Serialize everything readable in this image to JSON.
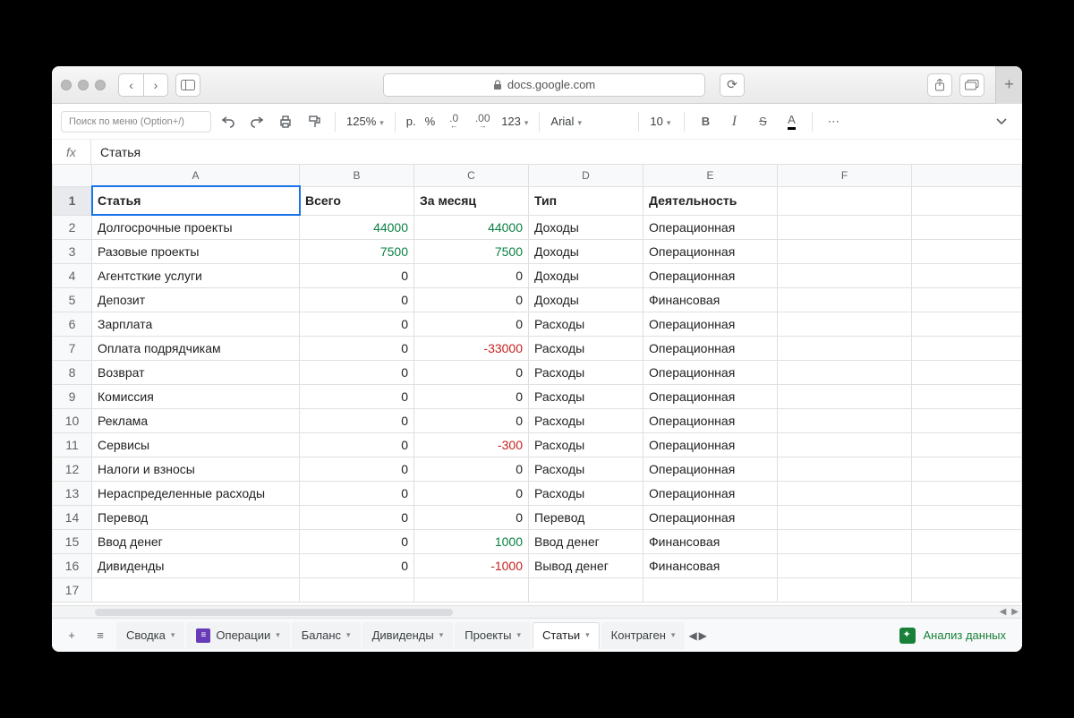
{
  "browser": {
    "url_host": "docs.google.com"
  },
  "toolbar": {
    "menu_search_placeholder": "Поиск по меню (Option+/)",
    "zoom": "125%",
    "currency": "р.",
    "percent": "%",
    "dec_less": ".0",
    "dec_more": ".00",
    "num123": "123",
    "font": "Arial",
    "font_size": "10",
    "bold": "B",
    "italic": "I",
    "strike": "S",
    "textcolor": "A",
    "more": "⋯"
  },
  "formula": {
    "label": "fx",
    "value": "Статья"
  },
  "columns": [
    "A",
    "B",
    "C",
    "D",
    "E",
    "F"
  ],
  "header": {
    "A": "Статья",
    "B": "Всего",
    "C": "За месяц",
    "D": "Тип",
    "E": "Деятельность"
  },
  "rows": [
    {
      "n": 2,
      "A": "Долгосрочные проекты",
      "B": "44000",
      "Bcls": "green",
      "C": "44000",
      "Ccls": "green",
      "D": "Доходы",
      "E": "Операционная"
    },
    {
      "n": 3,
      "A": "Разовые проекты",
      "B": "7500",
      "Bcls": "green",
      "C": "7500",
      "Ccls": "green",
      "D": "Доходы",
      "E": "Операционная"
    },
    {
      "n": 4,
      "A": "Агентсткие услуги",
      "B": "0",
      "C": "0",
      "D": "Доходы",
      "E": "Операционная"
    },
    {
      "n": 5,
      "A": "Депозит",
      "B": "0",
      "C": "0",
      "D": "Доходы",
      "E": "Финансовая"
    },
    {
      "n": 6,
      "A": "Зарплата",
      "B": "0",
      "C": "0",
      "D": "Расходы",
      "E": "Операционная"
    },
    {
      "n": 7,
      "A": "Оплата подрядчикам",
      "B": "0",
      "C": "-33000",
      "Ccls": "red",
      "D": "Расходы",
      "E": "Операционная"
    },
    {
      "n": 8,
      "A": "Возврат",
      "B": "0",
      "C": "0",
      "D": "Расходы",
      "E": "Операционная"
    },
    {
      "n": 9,
      "A": "Комиссия",
      "B": "0",
      "C": "0",
      "D": "Расходы",
      "E": "Операционная"
    },
    {
      "n": 10,
      "A": "Реклама",
      "B": "0",
      "C": "0",
      "D": "Расходы",
      "E": "Операционная"
    },
    {
      "n": 11,
      "A": "Сервисы",
      "B": "0",
      "C": "-300",
      "Ccls": "red",
      "D": "Расходы",
      "E": "Операционная"
    },
    {
      "n": 12,
      "A": "Налоги и взносы",
      "B": "0",
      "C": "0",
      "D": "Расходы",
      "E": "Операционная"
    },
    {
      "n": 13,
      "A": "Нераспределенные расходы",
      "B": "0",
      "C": "0",
      "D": "Расходы",
      "E": "Операционная"
    },
    {
      "n": 14,
      "A": "Перевод",
      "B": "0",
      "C": "0",
      "D": "Перевод",
      "E": "Операционная"
    },
    {
      "n": 15,
      "A": "Ввод денег",
      "B": "0",
      "C": "1000",
      "Ccls": "green",
      "D": "Ввод денег",
      "E": "Финансовая"
    },
    {
      "n": 16,
      "A": "Дивиденды",
      "B": "0",
      "C": "-1000",
      "Ccls": "red",
      "D": "Вывод денег",
      "E": "Финансовая"
    },
    {
      "n": 17,
      "A": "",
      "B": "",
      "C": "",
      "D": "",
      "E": ""
    }
  ],
  "tabs": {
    "items": [
      {
        "label": "Сводка",
        "badge": false
      },
      {
        "label": "Операции",
        "badge": true
      },
      {
        "label": "Баланс",
        "badge": false
      },
      {
        "label": "Дивиденды",
        "badge": false
      },
      {
        "label": "Проекты",
        "badge": false
      },
      {
        "label": "Статьи",
        "badge": false,
        "active": true
      },
      {
        "label": "Контраген",
        "badge": false
      }
    ],
    "explore": "Анализ данных"
  }
}
